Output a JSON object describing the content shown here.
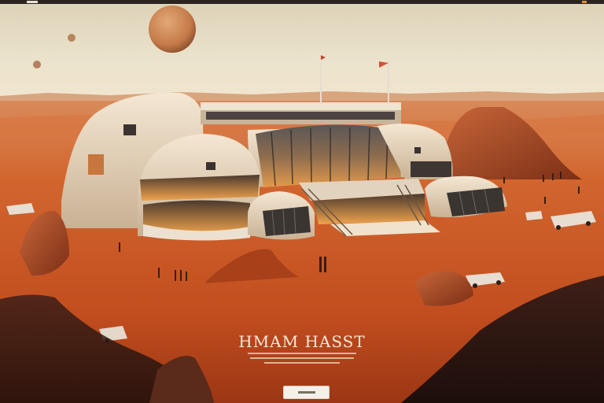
{
  "hero": {
    "title": "HMAM HASST"
  },
  "colors": {
    "sky": "#e8dcc2",
    "desert": "#c7521f",
    "dune_shadow": "#8f2f12",
    "habitat_shell": "#ead9c0",
    "window_glow": "#f2a24a",
    "title_text": "#f6e8da",
    "cta_background": "#f4efe9"
  },
  "icons": {
    "flag_left": "flag-icon",
    "flag_right": "flag-icon"
  }
}
